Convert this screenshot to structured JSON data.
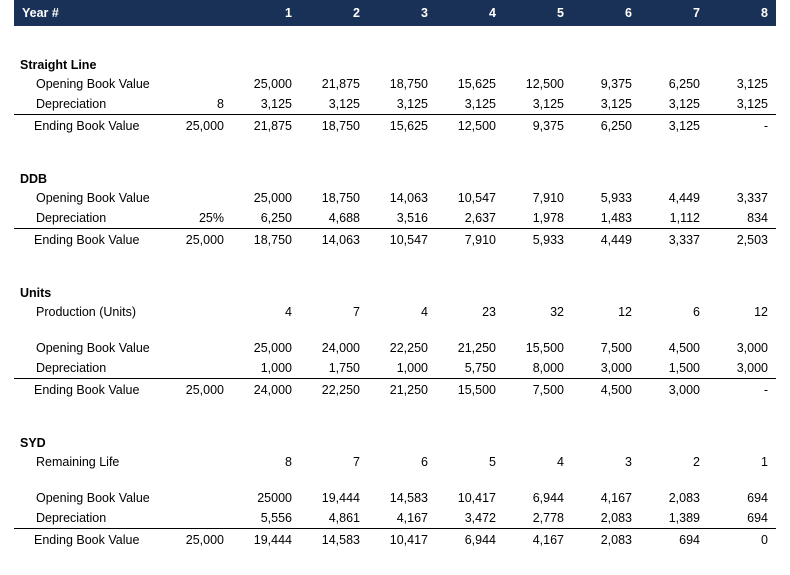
{
  "header": {
    "label": "Year #",
    "base_col": "",
    "years": [
      "1",
      "2",
      "3",
      "4",
      "5",
      "6",
      "7",
      "8"
    ]
  },
  "colors": {
    "header_background": "#1a3157",
    "header_text": "#ffffff",
    "body_text": "#000000",
    "rule": "#000000",
    "page_background": "#ffffff"
  },
  "sections": [
    {
      "title": "Straight Line",
      "rows": [
        {
          "label": "Opening Book Value",
          "base": "",
          "values": [
            "25,000",
            "21,875",
            "18,750",
            "15,625",
            "12,500",
            "9,375",
            "6,250",
            "3,125"
          ],
          "style": "normal"
        },
        {
          "label": "Depreciation",
          "base": "8",
          "values": [
            "3,125",
            "3,125",
            "3,125",
            "3,125",
            "3,125",
            "3,125",
            "3,125",
            "3,125"
          ],
          "style": "normal"
        },
        {
          "label": "Ending Book Value",
          "base": "25,000",
          "values": [
            "21,875",
            "18,750",
            "15,625",
            "12,500",
            "9,375",
            "6,250",
            "3,125",
            "-"
          ],
          "style": "total"
        }
      ]
    },
    {
      "title": "DDB",
      "rows": [
        {
          "label": "Opening Book Value",
          "base": "",
          "values": [
            "25,000",
            "18,750",
            "14,063",
            "10,547",
            "7,910",
            "5,933",
            "4,449",
            "3,337"
          ],
          "style": "normal"
        },
        {
          "label": "Depreciation",
          "base": "25%",
          "values": [
            "6,250",
            "4,688",
            "3,516",
            "2,637",
            "1,978",
            "1,483",
            "1,112",
            "834"
          ],
          "style": "normal"
        },
        {
          "label": "Ending Book Value",
          "base": "25,000",
          "values": [
            "18,750",
            "14,063",
            "10,547",
            "7,910",
            "5,933",
            "4,449",
            "3,337",
            "2,503"
          ],
          "style": "total"
        }
      ]
    },
    {
      "title": "Units",
      "rows": [
        {
          "label": "Production (Units)",
          "base": "",
          "values": [
            "4",
            "7",
            "4",
            "23",
            "32",
            "12",
            "6",
            "12"
          ],
          "style": "normal"
        },
        {
          "label": "",
          "base": "",
          "values": [
            "",
            "",
            "",
            "",
            "",
            "",
            "",
            ""
          ],
          "style": "spacer"
        },
        {
          "label": "Opening Book Value",
          "base": "",
          "values": [
            "25,000",
            "24,000",
            "22,250",
            "21,250",
            "15,500",
            "7,500",
            "4,500",
            "3,000"
          ],
          "style": "normal"
        },
        {
          "label": "Depreciation",
          "base": "",
          "values": [
            "1,000",
            "1,750",
            "1,000",
            "5,750",
            "8,000",
            "3,000",
            "1,500",
            "3,000"
          ],
          "style": "normal"
        },
        {
          "label": "Ending Book Value",
          "base": "25,000",
          "values": [
            "24,000",
            "22,250",
            "21,250",
            "15,500",
            "7,500",
            "4,500",
            "3,000",
            "-"
          ],
          "style": "total"
        }
      ]
    },
    {
      "title": "SYD",
      "rows": [
        {
          "label": "Remaining Life",
          "base": "",
          "values": [
            "8",
            "7",
            "6",
            "5",
            "4",
            "3",
            "2",
            "1"
          ],
          "style": "normal"
        },
        {
          "label": "",
          "base": "",
          "values": [
            "",
            "",
            "",
            "",
            "",
            "",
            "",
            ""
          ],
          "style": "spacer"
        },
        {
          "label": "Opening Book Value",
          "base": "",
          "values": [
            "25000",
            "19,444",
            "14,583",
            "10,417",
            "6,944",
            "4,167",
            "2,083",
            "694"
          ],
          "style": "normal"
        },
        {
          "label": "Depreciation",
          "base": "",
          "values": [
            "5,556",
            "4,861",
            "4,167",
            "3,472",
            "2,778",
            "2,083",
            "1,389",
            "694"
          ],
          "style": "normal"
        },
        {
          "label": "Ending Book Value",
          "base": "25,000",
          "values": [
            "19,444",
            "14,583",
            "10,417",
            "6,944",
            "4,167",
            "2,083",
            "694",
            "0"
          ],
          "style": "total"
        }
      ]
    }
  ]
}
